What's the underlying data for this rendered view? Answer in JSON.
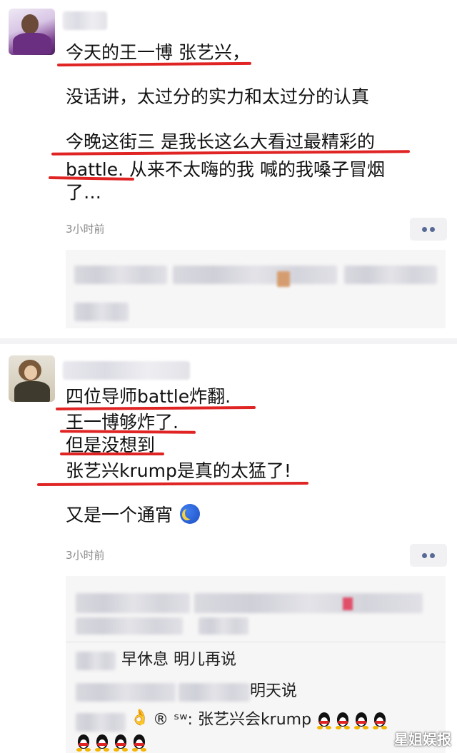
{
  "post1": {
    "lines": [
      "今天的王一博 张艺兴，",
      "没话讲，太过分的实力和太过分的认真",
      "今晚这街三 是我长这么大看过最精彩的",
      "battle. 从来不太嗨的我 喊的我嗓子冒烟",
      "了…"
    ],
    "time": "3小时前"
  },
  "post2": {
    "lines": [
      "四位导师battle炸翻.",
      "王一博够炸了.",
      "但是没想到",
      "张艺兴krump是真的太猛了!",
      "又是一个通宵"
    ],
    "time": "3小时前",
    "comments": {
      "c1_text": "早休息  明儿再说",
      "c2_text": "明天说",
      "c3_text": "® ˢʷ: 张艺兴会krump"
    }
  },
  "watermark": "星姐娱报",
  "colors": {
    "underline": "#e02424",
    "link": "#576b95",
    "comment_bg": "#f6f6f6"
  },
  "icons": [
    "more-icon",
    "moon-emoji-icon",
    "qq-penguin-icon",
    "ok-hand-emoji-icon"
  ]
}
